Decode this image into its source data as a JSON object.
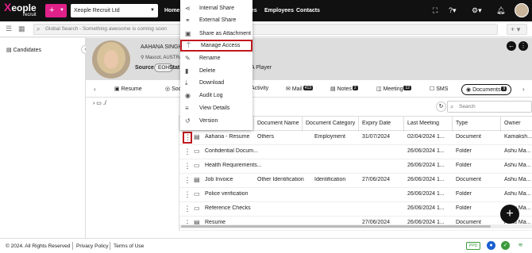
{
  "header": {
    "logo_main": "eople",
    "logo_x": "X",
    "logo_sub": "recruit",
    "add_label": "+",
    "company": "Xeople Recruit Ltd",
    "nav": [
      "Home",
      "...es",
      "Employees",
      "Contacts"
    ]
  },
  "search": {
    "placeholder": "Global Search - Something awesome is coming soon",
    "plus": "+"
  },
  "sidebar": {
    "items": [
      {
        "label": "Candidates"
      }
    ]
  },
  "profile": {
    "name": "AAHANA SINGH",
    "location": "Mascot, AUSTRALIA",
    "source_label": "Source",
    "source_value": "EOH",
    "status_label": "Stat",
    "rating": "A Player"
  },
  "tabs": [
    {
      "label": "Resume"
    },
    {
      "label": "Soci..."
    },
    {
      "label": "Activity"
    },
    {
      "label": "Mail",
      "badge": "413"
    },
    {
      "label": "Notes",
      "badge": "2"
    },
    {
      "label": "Meeting",
      "badge": "12"
    },
    {
      "label": "SMS"
    },
    {
      "label": "Documents",
      "badge": "9"
    }
  ],
  "tree_root": "./",
  "doc_search_placeholder": "Search",
  "table": {
    "columns": [
      "Document Name",
      "Document Category",
      "Expiry Date",
      "Last Meeting",
      "Type",
      "Owner"
    ],
    "rows": [
      {
        "name": "Aahana - Resume",
        "doc_name": "Others",
        "category": "Employment",
        "expiry": "31/07/2024",
        "last": "02/04/2024 1...",
        "type": "Document",
        "owner": "Kamaksh...",
        "icon": "file"
      },
      {
        "name": "Confidential Docum...",
        "doc_name": "",
        "category": "",
        "expiry": "",
        "last": "26/06/2024 1...",
        "type": "Folder",
        "owner": "Ashu Ma...",
        "icon": "folder"
      },
      {
        "name": "Health Requirements...",
        "doc_name": "",
        "category": "",
        "expiry": "",
        "last": "26/06/2024 1...",
        "type": "Folder",
        "owner": "Ashu Ma...",
        "icon": "folder"
      },
      {
        "name": "Job Invoice",
        "doc_name": "Other Identification",
        "category": "Identification",
        "expiry": "27/06/2024",
        "last": "26/06/2024 1...",
        "type": "Document",
        "owner": "Ashu Ma...",
        "icon": "file"
      },
      {
        "name": "Police verification",
        "doc_name": "",
        "category": "",
        "expiry": "",
        "last": "26/06/2024 1...",
        "type": "Folder",
        "owner": "Ashu Ma...",
        "icon": "folder"
      },
      {
        "name": "Reference Checks",
        "doc_name": "",
        "category": "",
        "expiry": "",
        "last": "26/06/2024 1...",
        "type": "Folder",
        "owner": "Ashu Ma...",
        "icon": "folder"
      },
      {
        "name": "Resume",
        "doc_name": "",
        "category": "",
        "expiry": "27/06/2024",
        "last": "26/06/2024 1...",
        "type": "Document",
        "owner": "Ashu Ma...",
        "icon": "file"
      }
    ]
  },
  "context_menu": {
    "items": [
      {
        "label": "Internal Share",
        "icon": "share-icon"
      },
      {
        "label": "External Share",
        "icon": "link-icon"
      },
      {
        "label": "Share as Attachment",
        "icon": "attachment-icon"
      },
      {
        "label": "Manage Access",
        "icon": "access-icon",
        "highlighted": true
      },
      {
        "label": "Rename",
        "icon": "edit-icon"
      },
      {
        "label": "Delete",
        "icon": "trash-icon"
      },
      {
        "label": "Download",
        "icon": "download-icon"
      },
      {
        "label": "Audit Log",
        "icon": "eye-icon"
      },
      {
        "label": "View Details",
        "icon": "list-icon"
      },
      {
        "label": "Version",
        "icon": "history-icon"
      }
    ]
  },
  "footer": {
    "copyright": "© 2024. All Rights Reserved",
    "privacy": "Privacy Policy",
    "terms": "Terms of Use",
    "badge": "PPD"
  },
  "colors": {
    "brand": "#e0218a",
    "topbar": "#111111",
    "highlight": "#c0181e"
  }
}
